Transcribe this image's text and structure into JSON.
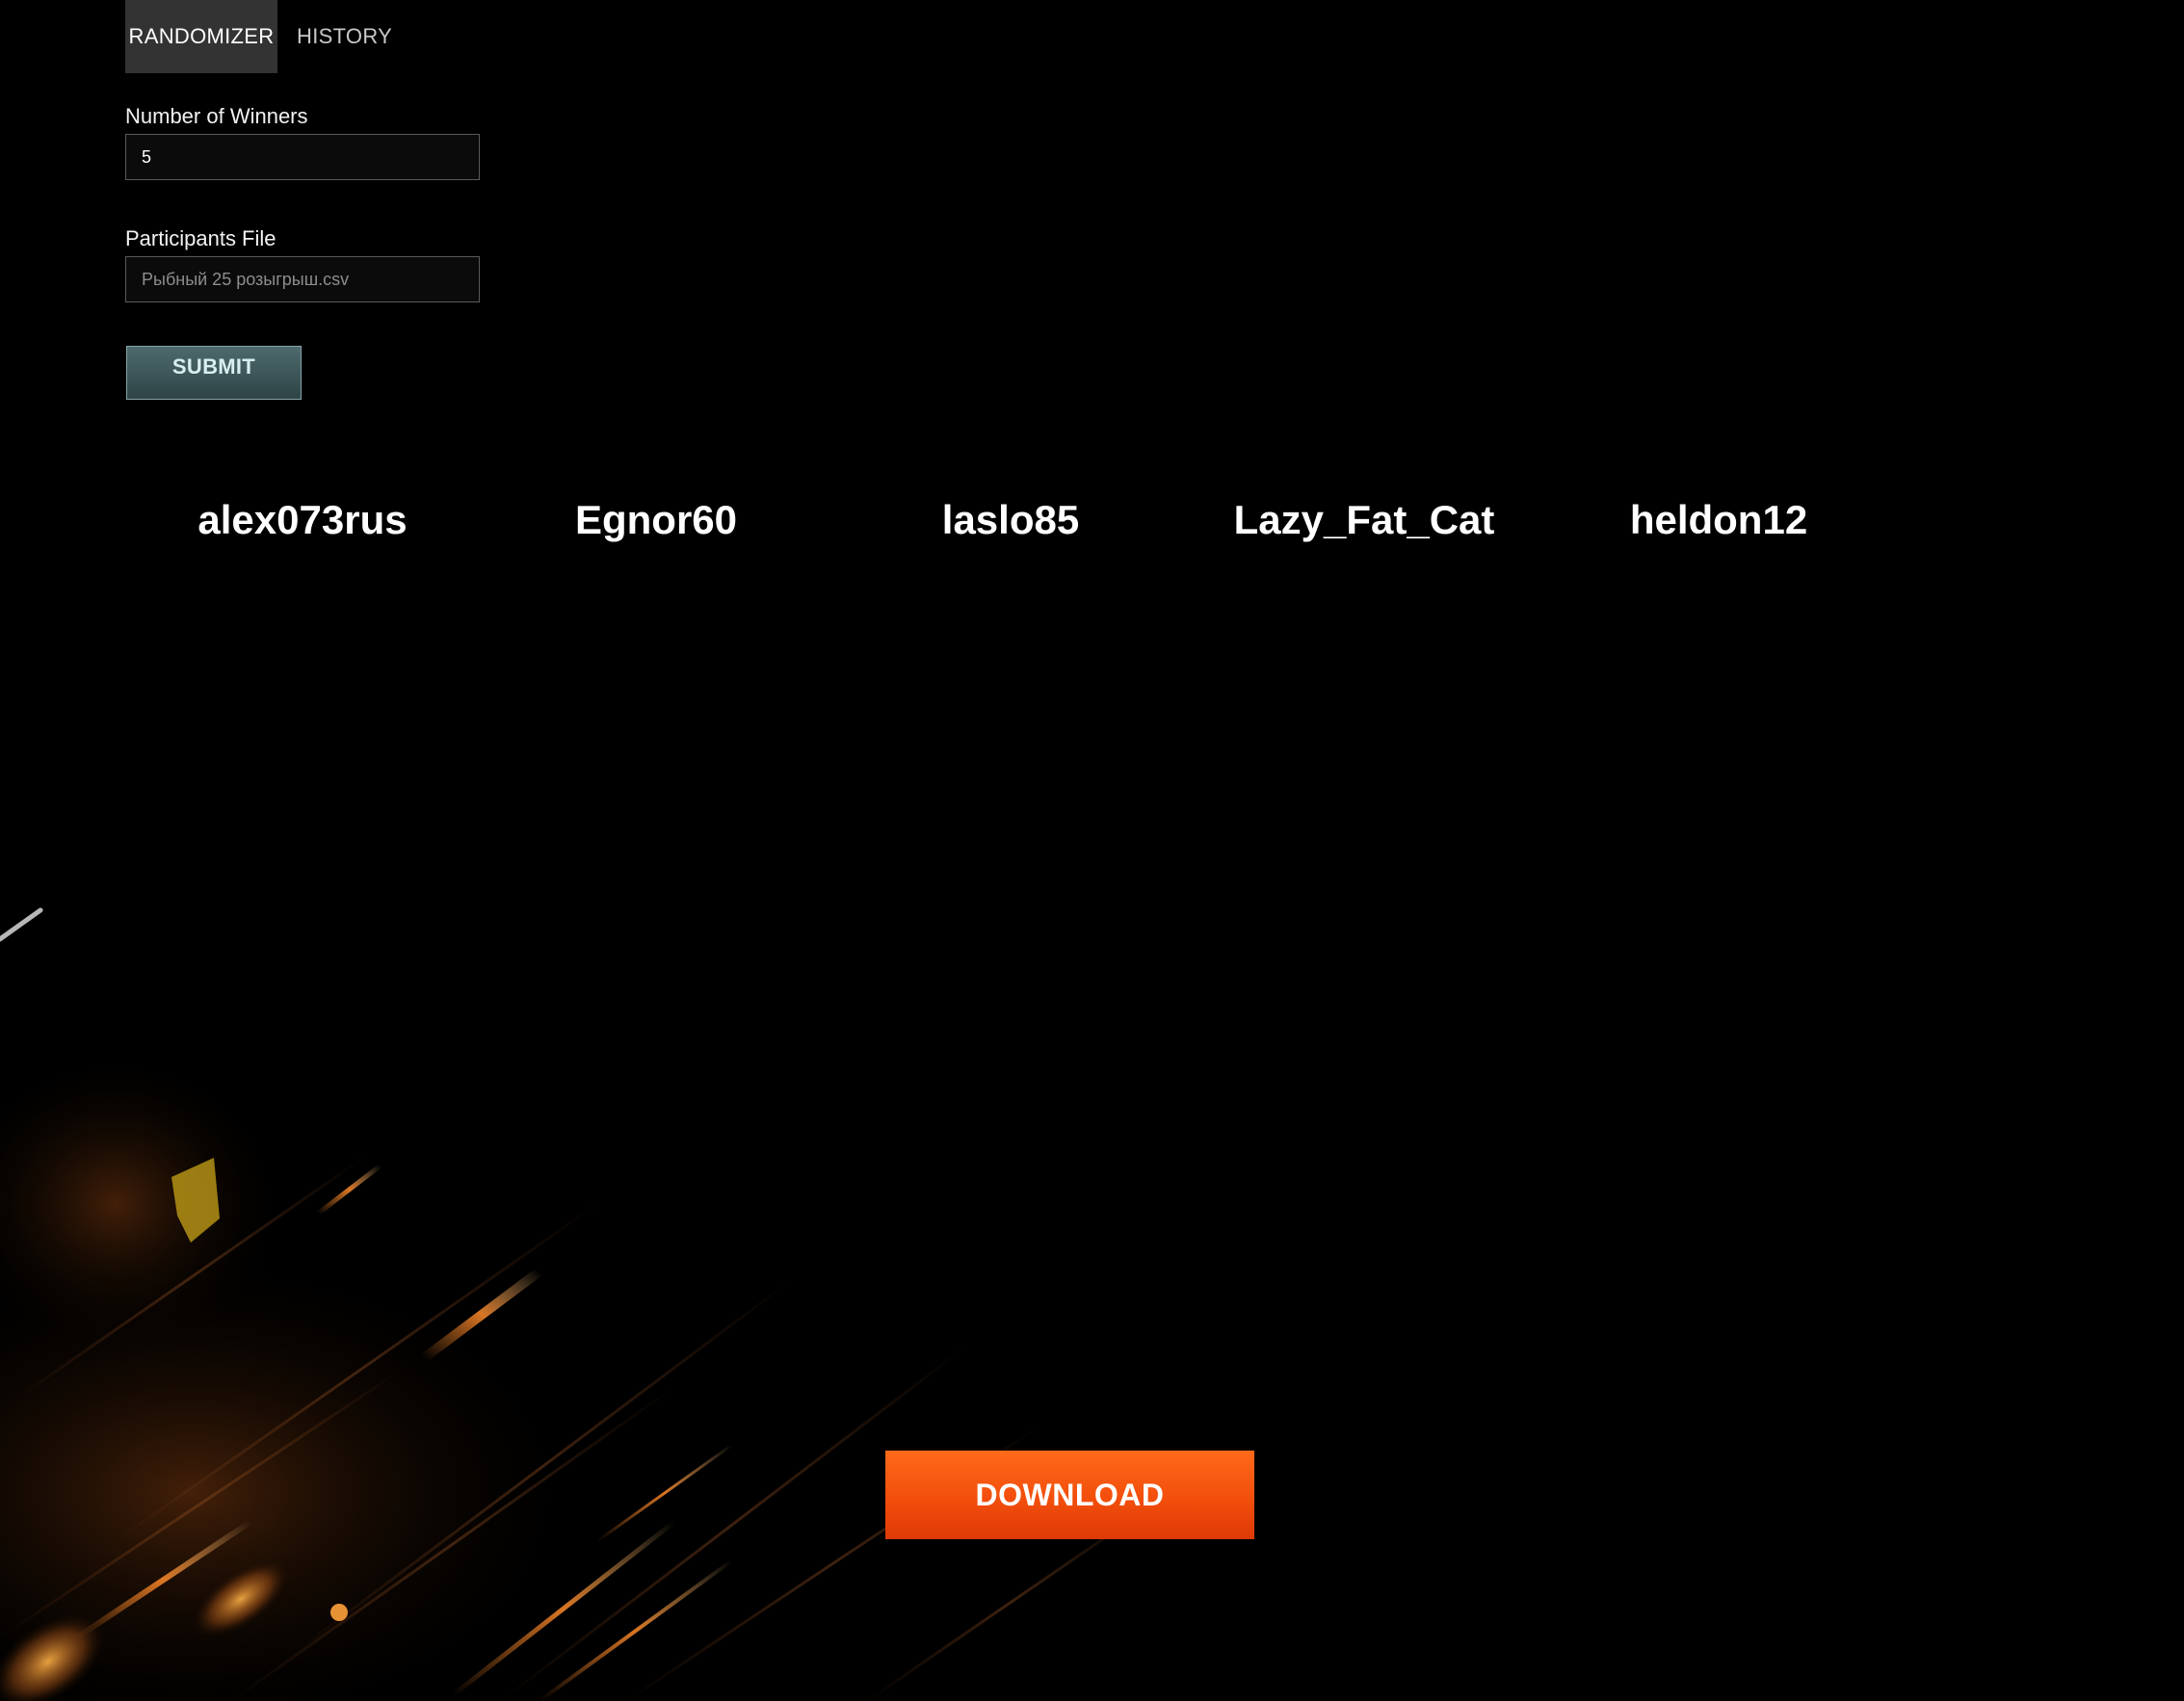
{
  "tabs": [
    {
      "label": "RANDOMIZER",
      "active": true
    },
    {
      "label": "HISTORY",
      "active": false
    }
  ],
  "form": {
    "winners_label": "Number of Winners",
    "winners_value": "5",
    "file_label": "Participants File",
    "file_value": "Рыбный 25 розыгрыш.csv",
    "submit_label": "SUBMIT"
  },
  "winners": [
    "alex073rus",
    "Egnor60",
    "laslo85",
    "Lazy_Fat_Cat",
    "heldon12"
  ],
  "download_label": "DOWNLOAD",
  "colors": {
    "background": "#000000",
    "active_tab_bg": "#333333",
    "submit_bg": "#4e6a6d",
    "download_bg": "#f24e0c"
  }
}
